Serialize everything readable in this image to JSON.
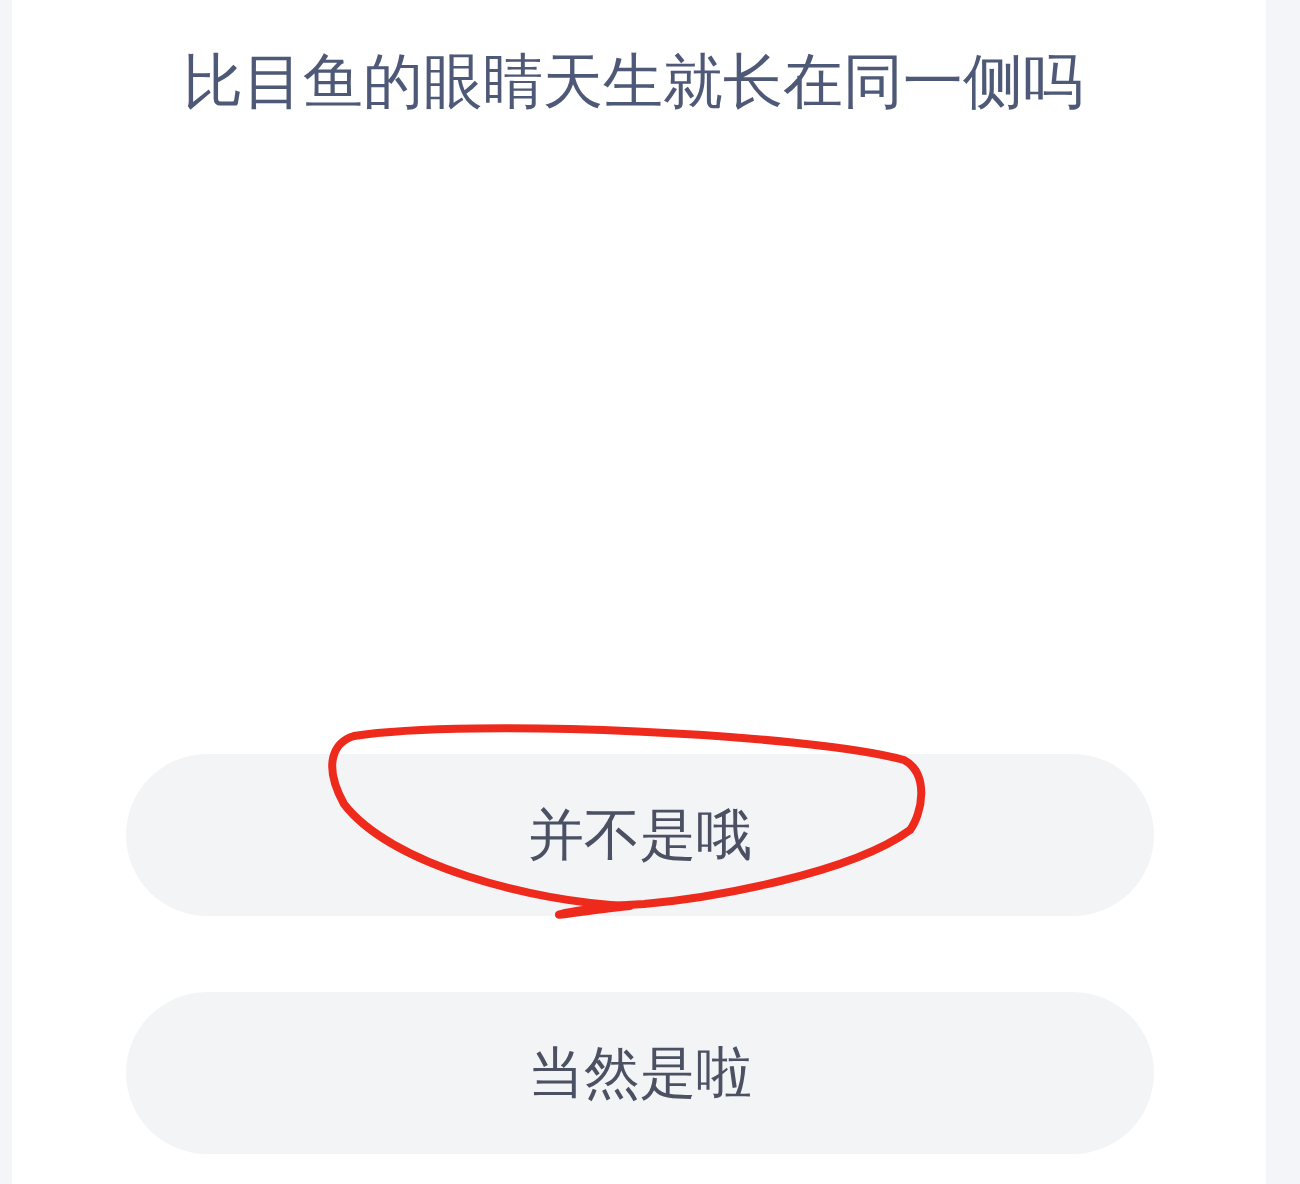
{
  "question": "比目鱼的眼睛天生就长在同一侧吗",
  "options": [
    {
      "label": "并不是哦",
      "circled": true
    },
    {
      "label": "当然是啦",
      "circled": false
    }
  ]
}
